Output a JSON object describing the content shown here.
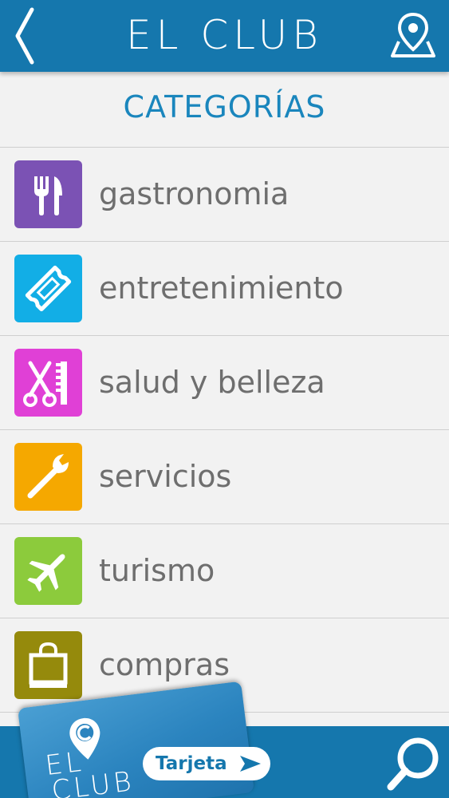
{
  "header": {
    "title": "EL CLUB",
    "back_icon": "chevron-left-icon",
    "map_icon": "map-pin-icon"
  },
  "section": {
    "title": "CATEGORÍAS"
  },
  "categories": [
    {
      "label": "gastronomia",
      "icon": "fork-knife-icon",
      "color": "#7b52b4"
    },
    {
      "label": "entretenimiento",
      "icon": "ticket-icon",
      "color": "#12aee6"
    },
    {
      "label": "salud y belleza",
      "icon": "scissors-comb-icon",
      "color": "#e040d6"
    },
    {
      "label": "servicios",
      "icon": "wrench-icon",
      "color": "#f5a800"
    },
    {
      "label": "turismo",
      "icon": "airplane-icon",
      "color": "#8ccb3c"
    },
    {
      "label": "compras",
      "icon": "shopping-bag-icon",
      "color": "#958a0c"
    }
  ],
  "bottom_bar": {
    "card_logo_line1": "EL",
    "card_logo_line2": "CLUB",
    "card_button_label": "Tarjeta",
    "search_icon": "search-icon"
  },
  "colors": {
    "primary": "#1577ad",
    "title_blue": "#1a86bd",
    "list_text": "#6e6e6e",
    "background": "#f2f2f2"
  }
}
